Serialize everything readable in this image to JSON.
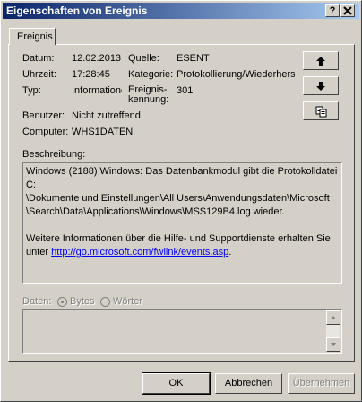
{
  "window": {
    "title": "Eigenschaften von Ereignis",
    "help_button": "?",
    "close_button": "X"
  },
  "tab": {
    "label": "Ereignis"
  },
  "fields": {
    "datum_label": "Datum:",
    "datum_value": "12.02.2013",
    "uhrzeit_label": "Uhrzeit:",
    "uhrzeit_value": "17:28:45",
    "typ_label": "Typ:",
    "typ_value": "Informationen",
    "benutzer_label": "Benutzer:",
    "benutzer_value": "Nicht zutreffend",
    "computer_label": "Computer:",
    "computer_value": "WHS1DATEN",
    "quelle_label": "Quelle:",
    "quelle_value": "ESENT",
    "kategorie_label": "Kategorie:",
    "kategorie_value": "Protokollierung/Wiederherstellung",
    "kennung_label_1": "Ereignis-",
    "kennung_label_2": "kennung:",
    "kennung_value": "301"
  },
  "description": {
    "label": "Beschreibung:",
    "lines": [
      "Windows (2188) Windows: Das Datenbankmodul gibt die Protokolldatei C:",
      "\\Dokumente und Einstellungen\\All Users\\Anwendungsdaten\\Microsoft",
      "\\Search\\Data\\Applications\\Windows\\MSS129B4.log wieder."
    ],
    "more_info": "Weitere Informationen über die Hilfe- und Supportdienste erhalten Sie",
    "more_info_prefix": "unter",
    "link": "http://go.microsoft.com/fwlink/events.asp",
    "link_suffix": "."
  },
  "data": {
    "label": "Daten:",
    "option_bytes": "Bytes",
    "option_words": "Wörter",
    "selected": "Bytes"
  },
  "buttons": {
    "ok": "OK",
    "cancel": "Abbrechen",
    "apply": "Übernehmen"
  },
  "icons": {
    "up": "arrow-up-icon",
    "down": "arrow-down-icon",
    "copy": "copy-icon"
  }
}
